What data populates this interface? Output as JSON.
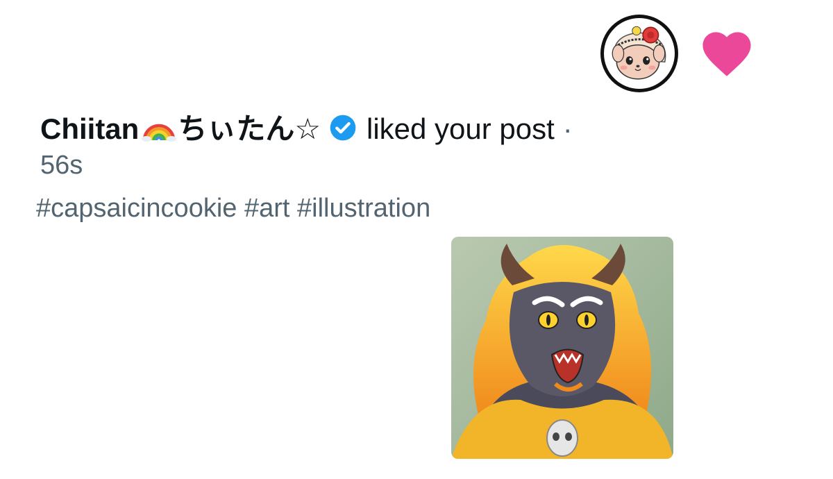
{
  "notification": {
    "type_icon": "heart-icon",
    "type_color": "#ec4899",
    "user": {
      "display_name": "Chiitan",
      "display_name_suffix": "ちぃたん☆",
      "name_emoji": "rainbow-icon",
      "verified": true,
      "verified_color": "#1d9bf0"
    },
    "action": "liked your post",
    "separator": "·",
    "timestamp": "56s",
    "post_text": "#capsaicincookie #art #illustration",
    "thumbnail_alt": "Illustration of a horned creature with flaming hair"
  }
}
